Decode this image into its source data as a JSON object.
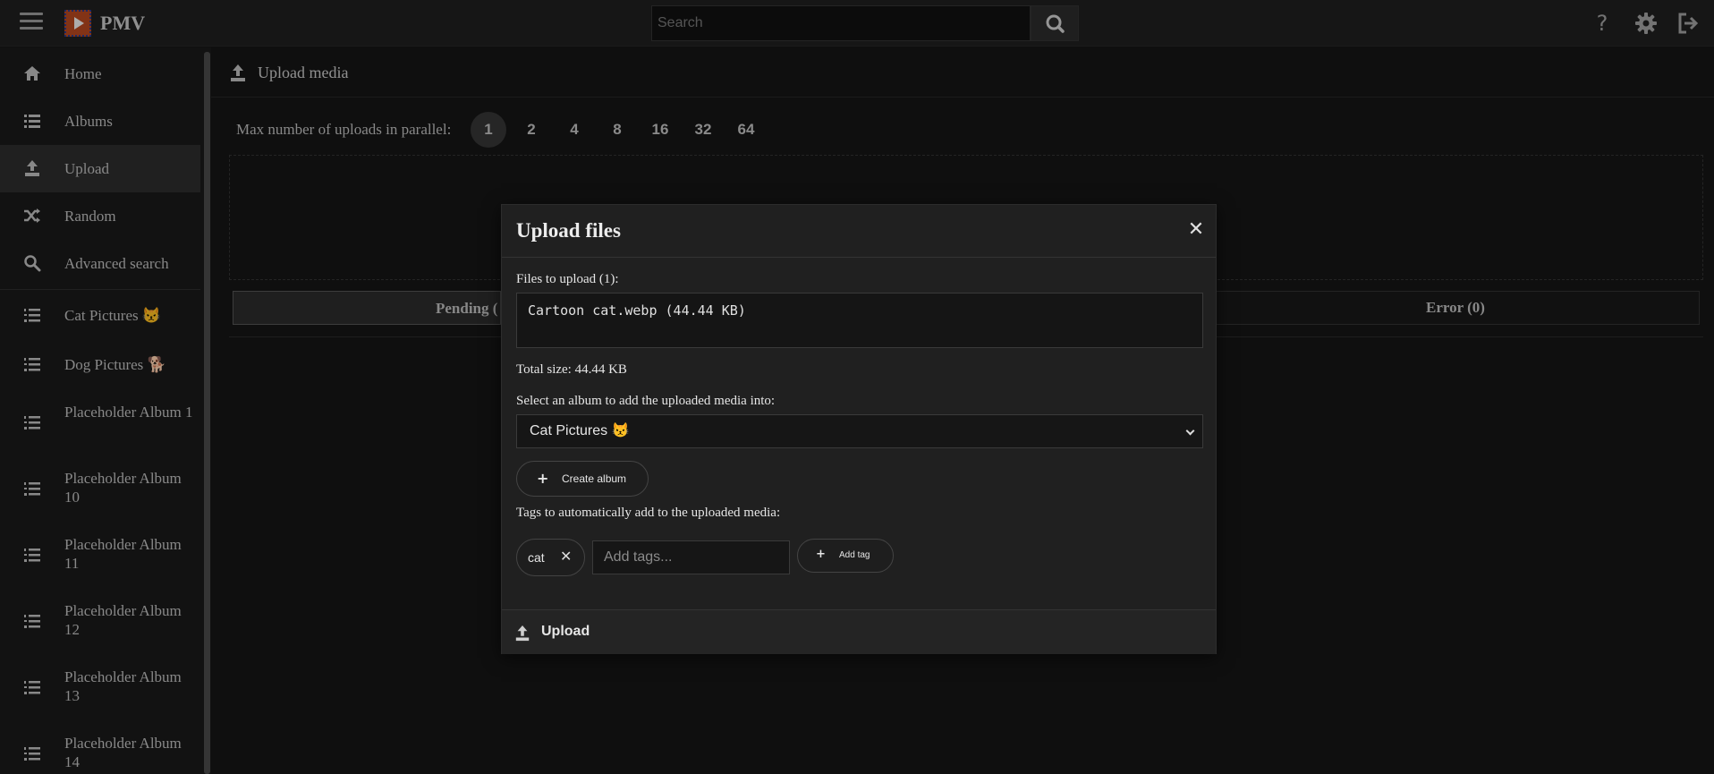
{
  "topbar": {
    "app_title": "PMV",
    "search_placeholder": "Search",
    "icons": [
      "menu-icon",
      "logo-icon",
      "search-icon",
      "help-icon",
      "gear-icon",
      "logout-icon"
    ]
  },
  "sidebar": {
    "items": [
      {
        "label": "Home",
        "icon": "home-icon"
      },
      {
        "label": "Albums",
        "icon": "list-icon"
      },
      {
        "label": "Upload",
        "icon": "upload-icon",
        "active": true
      },
      {
        "label": "Random",
        "icon": "shuffle-icon"
      },
      {
        "label": "Advanced search",
        "icon": "search-icon"
      }
    ],
    "albums": [
      {
        "label": "Cat Pictures 😾"
      },
      {
        "label": "Dog Pictures 🐕"
      },
      {
        "label": "Placeholder Album 1"
      },
      {
        "label": "Placeholder Album 10"
      },
      {
        "label": "Placeholder Album 11"
      },
      {
        "label": "Placeholder Album 12"
      },
      {
        "label": "Placeholder Album 13"
      },
      {
        "label": "Placeholder Album 14"
      }
    ]
  },
  "main": {
    "title": "Upload media",
    "parallel_label": "Max number of uploads in parallel:",
    "parallel_options": [
      "1",
      "2",
      "4",
      "8",
      "16",
      "32",
      "64"
    ],
    "parallel_selected": "1",
    "tabs": {
      "pending": "Pending (",
      "error": "Error (0)"
    }
  },
  "modal": {
    "title": "Upload files",
    "files_label": "Files to upload (1):",
    "files_list": "Cartoon cat.webp (44.44 KB)",
    "total_size": "Total size: 44.44 KB",
    "album_label": "Select an album to add the uploaded media into:",
    "album_selected": "Cat Pictures 😾",
    "create_album": "Create album",
    "tags_label": "Tags to automatically add to the uploaded media:",
    "tags": [
      "cat"
    ],
    "tag_input_placeholder": "Add tags...",
    "add_tag": "Add tag",
    "upload_button": "Upload"
  }
}
